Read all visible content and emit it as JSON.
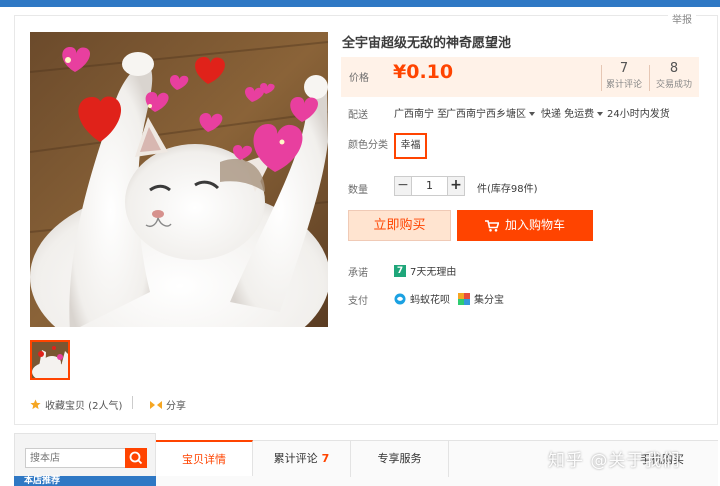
{
  "topbar": {
    "item1": "",
    "item2": ""
  },
  "report_label": "举报",
  "product": {
    "title": "全宇宙超级无敌的神奇愿望池",
    "price_label": "价格",
    "price": "¥0.10",
    "reviews_count": "7",
    "reviews_label": "累计评论",
    "deals_count": "8",
    "deals_label": "交易成功"
  },
  "shipping": {
    "label": "配送",
    "from": "广西南宁 至",
    "to": "广西南宁西乡塘区",
    "method": "快递 免运费",
    "time": "24小时内发货"
  },
  "color": {
    "label": "颜色分类",
    "option": "幸福"
  },
  "quantity": {
    "label": "数量",
    "minus": "−",
    "value": "1",
    "plus": "+",
    "stock": "件(库存98件)"
  },
  "actions": {
    "buy_now": "立即购买",
    "add_cart": "加入购物车"
  },
  "promise": {
    "label": "承诺",
    "icon_text": "7",
    "text": "7天无理由"
  },
  "payment": {
    "label": "支付",
    "huabei": "蚂蚁花呗",
    "jifen": "集分宝"
  },
  "favorite": {
    "text": "收藏宝贝 (2人气)"
  },
  "share": {
    "text": "分享"
  },
  "shop": {
    "search_placeholder": "搜本店",
    "section": "本店推荐"
  },
  "tabs": {
    "details": "宝贝详情",
    "reviews": "累计评论",
    "reviews_count": "7",
    "service": "专享服务"
  },
  "phone_buy": "手机购买",
  "watermark": "知乎 @关于我们",
  "colors": {
    "accent": "#ff4400",
    "topbar": "#2f78c4",
    "price_bg": "#fff2e8"
  }
}
